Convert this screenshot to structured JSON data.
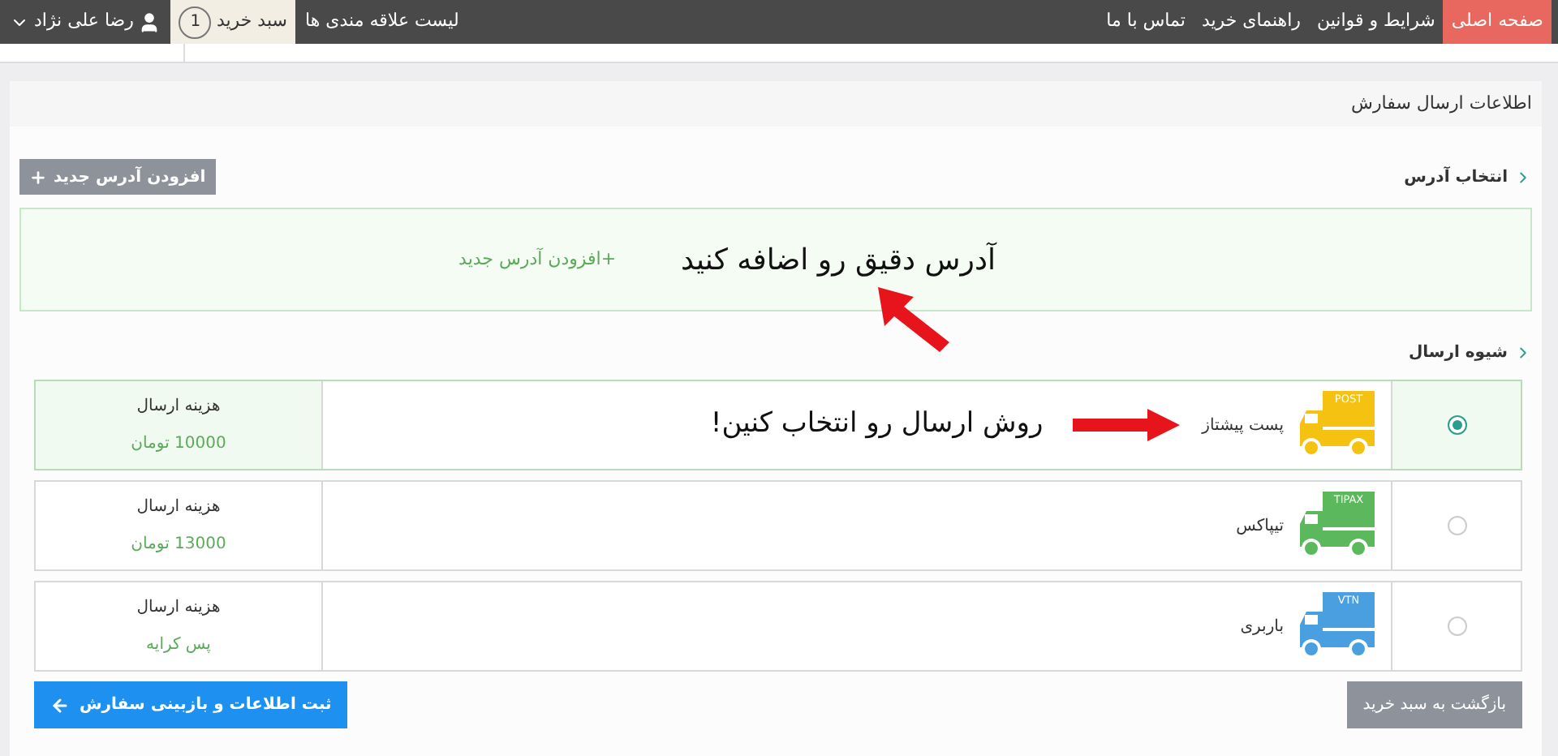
{
  "nav": {
    "items": [
      {
        "label": "صفحه اصلی",
        "selected": true
      },
      {
        "label": "شرایط و قوانین",
        "selected": false
      },
      {
        "label": "راهنمای خرید",
        "selected": false
      },
      {
        "label": "تماس با ما",
        "selected": false
      }
    ],
    "wishlist": "لیست علاقه مندی ها",
    "cart": {
      "label": "سبد خرید",
      "count": "1"
    },
    "user": "رضا علی نژاد"
  },
  "panel": {
    "title": "اطلاعات ارسال سفارش"
  },
  "address": {
    "heading": "انتخاب آدرس",
    "add_button": "افزودن آدرس جدید",
    "callout": "آدرس دقیق رو اضافه کنید",
    "add_link": "+افزودن آدرس جدید"
  },
  "shipping": {
    "heading": "شیوه ارسال",
    "callout": "روش ارسال رو انتخاب کنین!",
    "methods": [
      {
        "name": "پست پیشتاز",
        "badge": "POST",
        "color": "#f5c211",
        "selected": true,
        "cost_label": "هزینه ارسال",
        "cost": "10000 تومان"
      },
      {
        "name": "تیپاکس",
        "badge": "TIPAX",
        "color": "#5cb85c",
        "selected": false,
        "cost_label": "هزینه ارسال",
        "cost": "13000 تومان"
      },
      {
        "name": "باربری",
        "badge": "VTN",
        "color": "#4a9fe0",
        "selected": false,
        "cost_label": "هزینه ارسال",
        "cost": "پس کرایه"
      }
    ]
  },
  "footer": {
    "back": "بازگشت به سبد خرید",
    "submit": "ثبت اطلاعات و بازبینی سفارش"
  }
}
